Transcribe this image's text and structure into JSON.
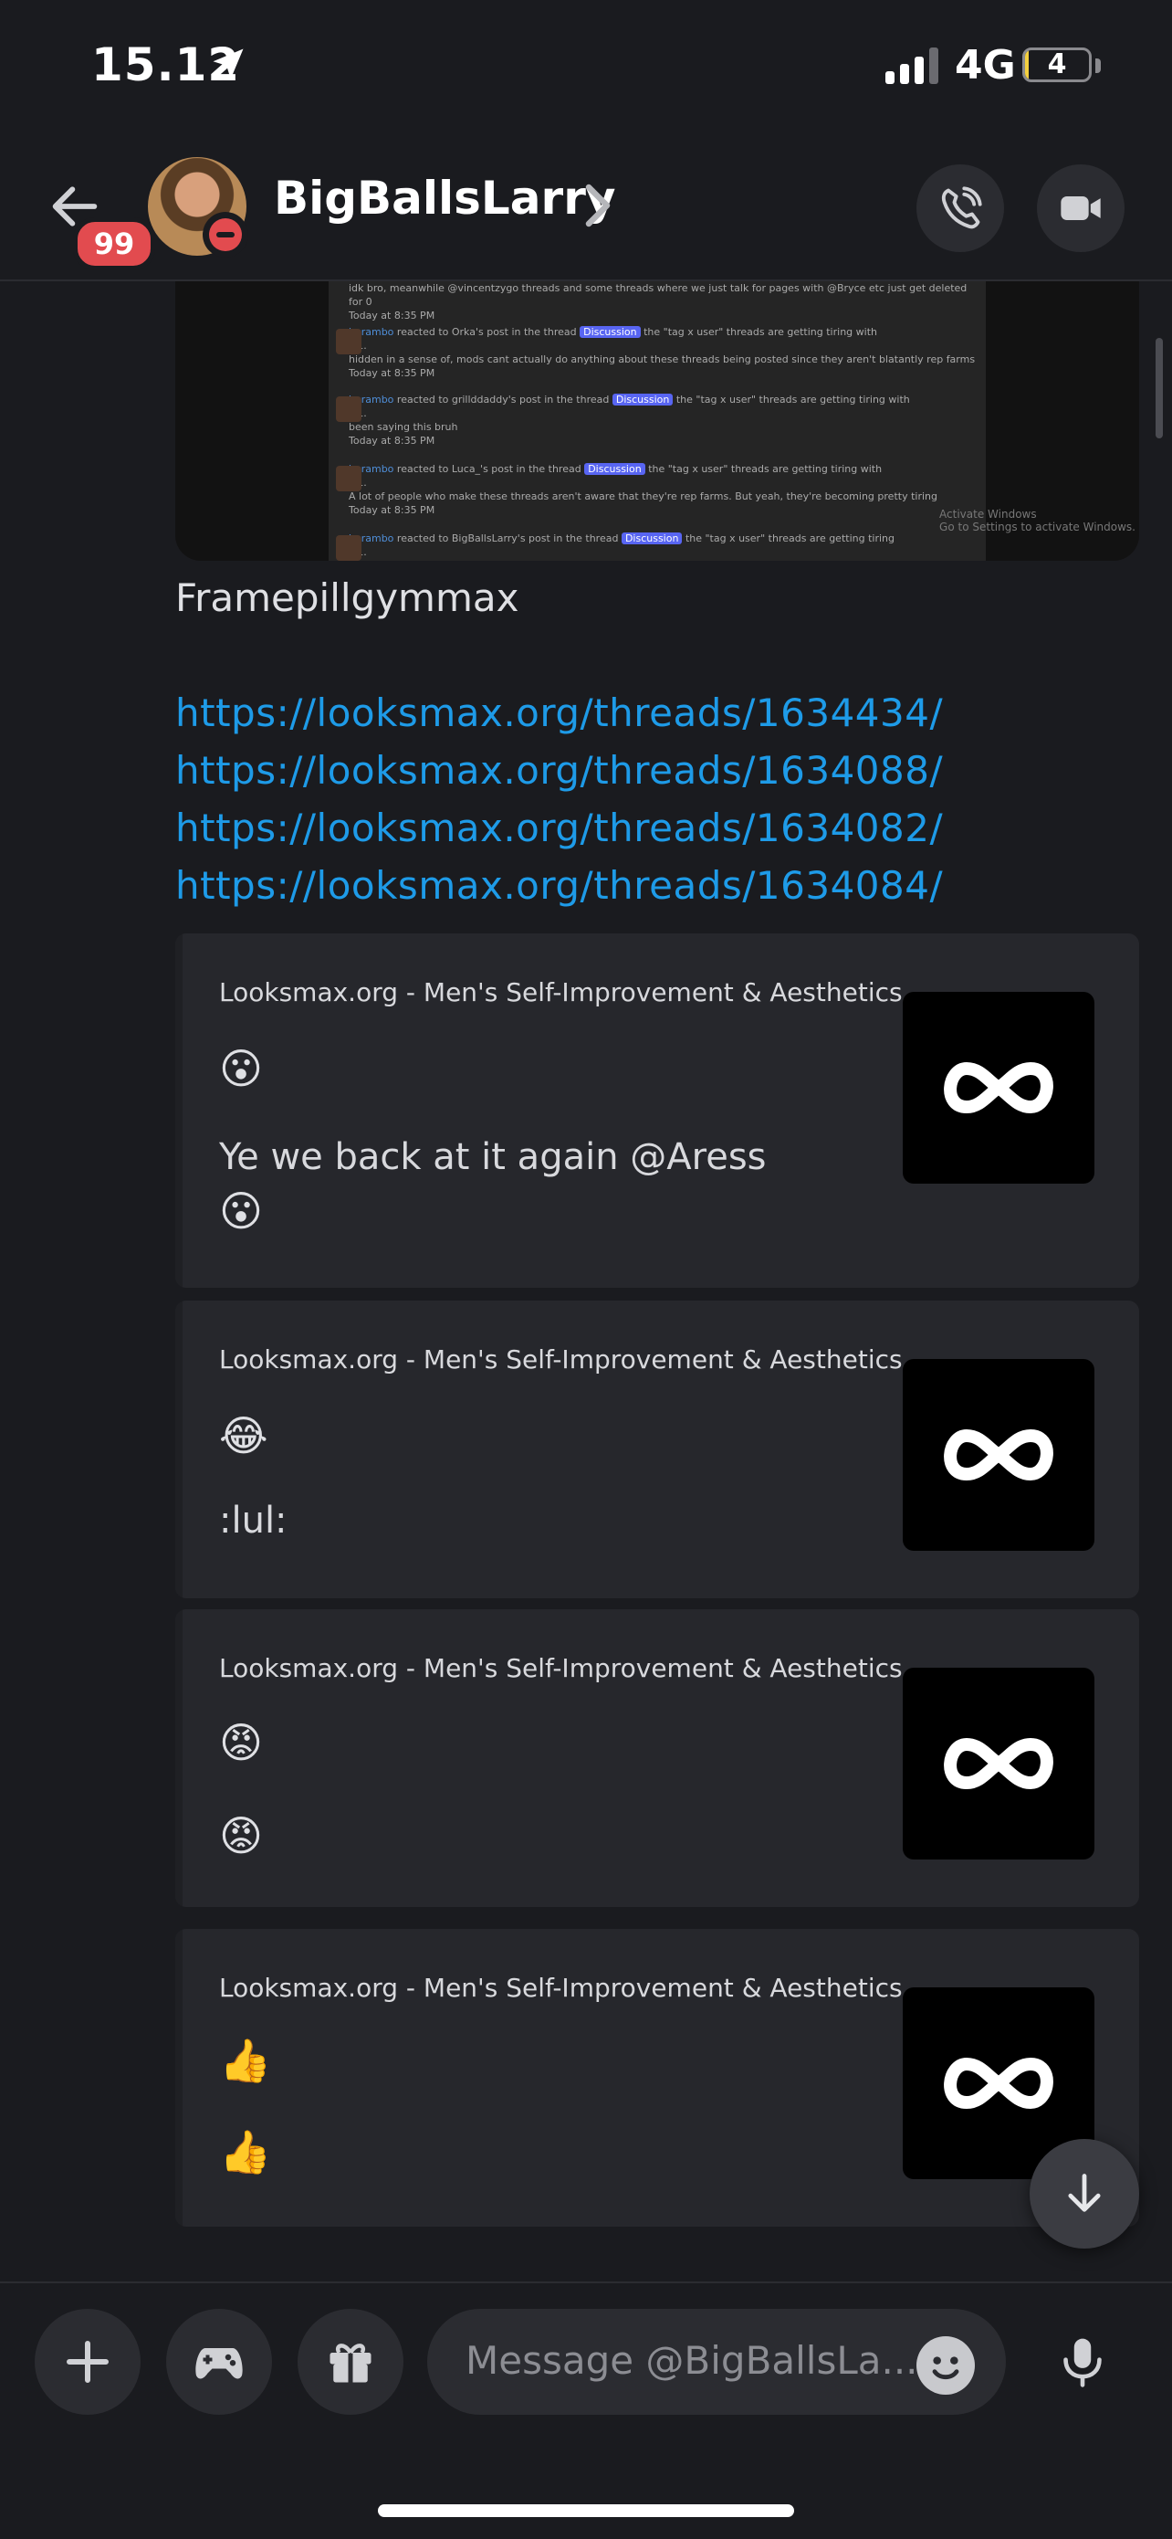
{
  "status_bar": {
    "time": "15.12",
    "network": "4G",
    "battery": "4",
    "battery_level_percent": 4
  },
  "header": {
    "back_badge": "99",
    "username": "BigBallsLarry"
  },
  "screenshot_preview": {
    "rows": [
      {
        "name": "",
        "text": "idk bro, meanwhile @vincentzygo threads and some threads where we just talk for pages with @Bryce etc just get deleted for 0",
        "time": "Today at 8:35 PM"
      },
      {
        "name": "barambo",
        "text": "reacted to Orka's post in the thread",
        "tag": "Discussion",
        "after": "the \"tag x user\" threads are getting tiring with",
        "plus": "+1.",
        "detail": "hidden in a sense of, mods cant actually do anything about these threads being posted since they aren't blatantly rep farms",
        "time": "Today at 8:35 PM"
      },
      {
        "name": "barambo",
        "text": "reacted to grillddaddy's post in the thread",
        "tag": "Discussion",
        "after": "the \"tag x user\" threads are getting tiring with",
        "plus": "+1.",
        "detail": "been saying this bruh",
        "time": "Today at 8:35 PM"
      },
      {
        "name": "barambo",
        "text": "reacted to Luca_'s post in the thread",
        "tag": "Discussion",
        "after": "the \"tag x user\" threads are getting tiring with",
        "plus": "+1.",
        "detail": "A lot of people who make these threads aren't aware that they're rep farms. But yeah, they're becoming pretty tiring",
        "time": "Today at 8:35 PM"
      },
      {
        "name": "barambo",
        "text": "reacted to BigBallsLarry's post in the thread",
        "tag": "Discussion",
        "after": "the \"tag x user\" threads are getting tiring",
        "plus": "+1.",
        "detail": "",
        "time": ""
      }
    ],
    "watermark_title": "Activate Windows",
    "watermark_sub": "Go to Settings to activate Windows."
  },
  "message": {
    "text": "Framepillgymmax",
    "links": [
      "https://looksmax.org/threads/1634434/",
      "https://looksmax.org/threads/1634088/",
      "https://looksmax.org/threads/1634082/",
      "https://looksmax.org/threads/1634084/"
    ]
  },
  "embeds": [
    {
      "provider": "Looksmax.org - Men's Self-Improvement & Aesthetics",
      "title_emoji": "😮",
      "description": "Ye we back at it again @Aress",
      "desc_emoji": "😮"
    },
    {
      "provider": "Looksmax.org - Men's Self-Improvement & Aesthetics",
      "title_emoji": "😂",
      "description": ":lul:",
      "desc_emoji": ""
    },
    {
      "provider": "Looksmax.org - Men's Self-Improvement & Aesthetics",
      "title_emoji": "😡",
      "description": "",
      "desc_emoji": "😡"
    },
    {
      "provider": "Looksmax.org - Men's Self-Improvement & Aesthetics",
      "title_emoji": "👍",
      "description": "",
      "desc_emoji": "👍"
    }
  ],
  "composer": {
    "placeholder": "Message @BigBallsLa..."
  },
  "colors": {
    "background": "#1a1b1f",
    "embed_background": "#26272c",
    "link": "#1e9be8",
    "badge": "#e24b4f"
  },
  "icons": {
    "location": "location-arrow-icon",
    "back": "arrow-left-icon",
    "call": "phone-call-icon",
    "video": "video-camera-icon",
    "add": "plus-icon",
    "games": "gamepad-icon",
    "gift": "gift-icon",
    "emoji": "emoji-face-icon",
    "mic": "microphone-icon",
    "jump": "arrow-down-icon",
    "embed_thumb": "infinity-logo-icon"
  }
}
